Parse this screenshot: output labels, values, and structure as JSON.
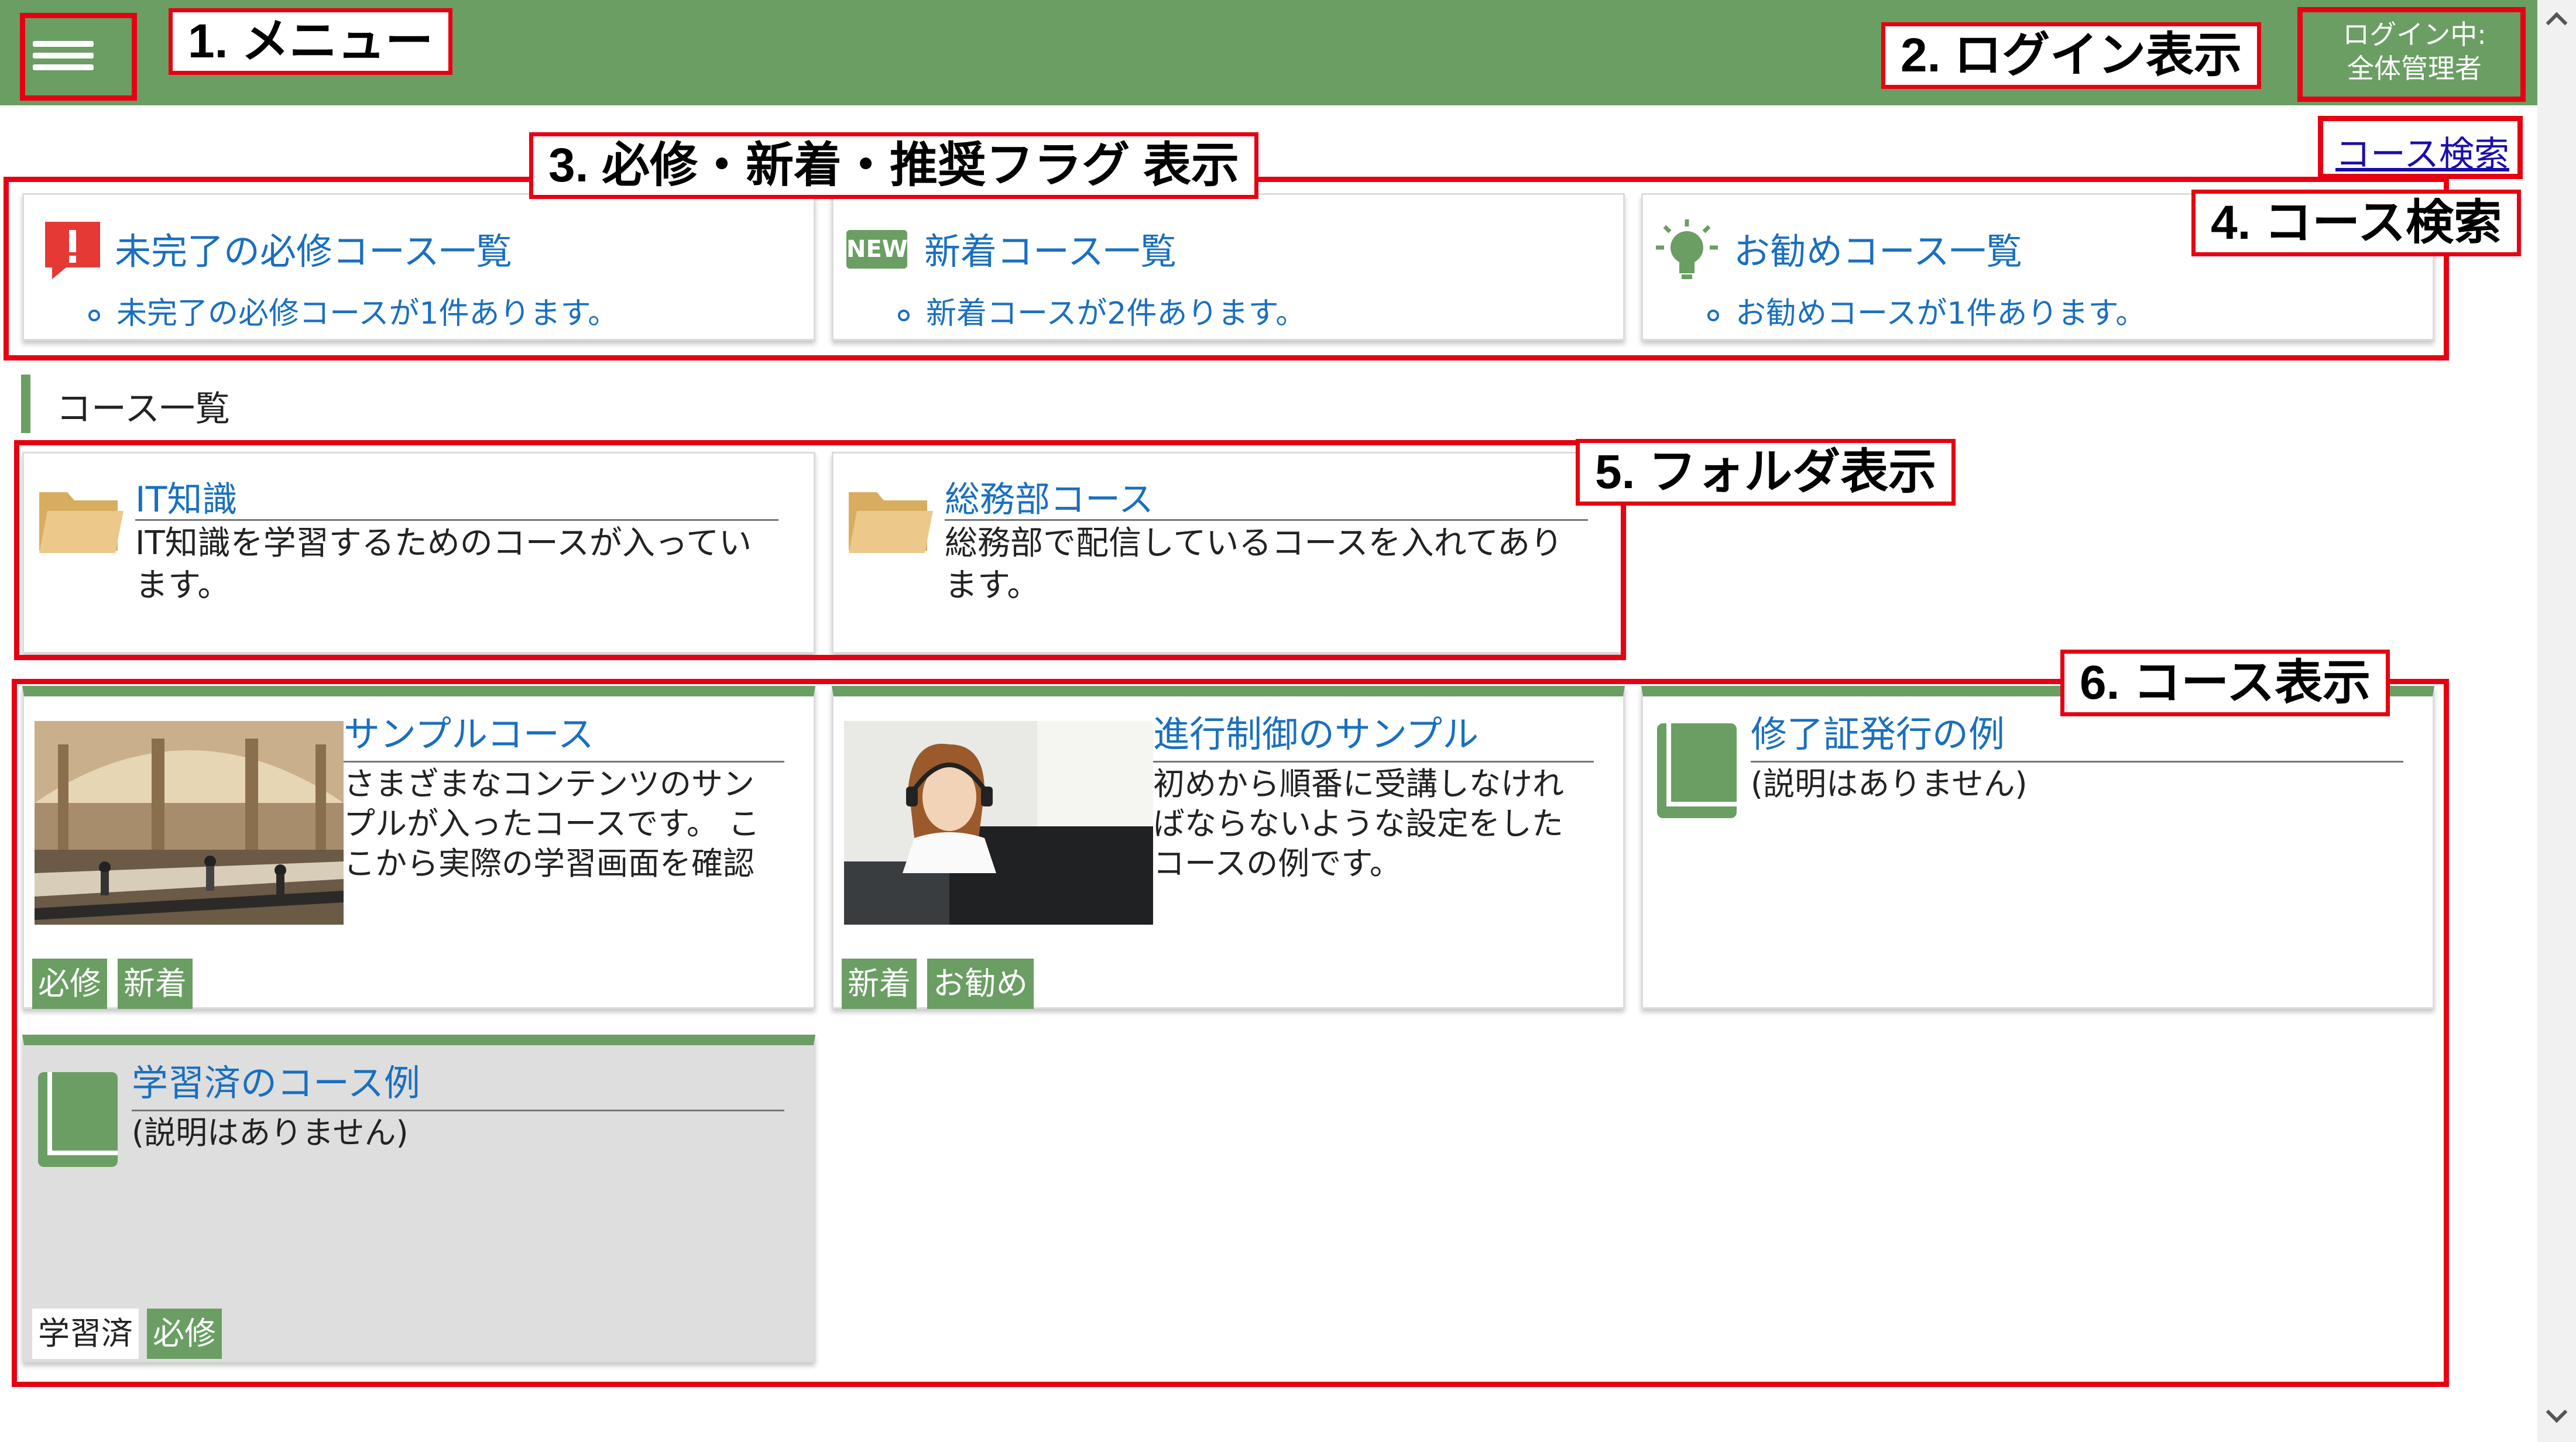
{
  "header": {
    "login_status": "ログイン中:",
    "login_user": "全体管理者"
  },
  "search": {
    "link_label": "コース検索"
  },
  "summary_cards": [
    {
      "title": "未完了の必修コース一覧",
      "detail": "未完了の必修コースが1件あります。",
      "icon": "alert-icon"
    },
    {
      "title": "新着コース一覧",
      "detail": "新着コースが2件あります。",
      "icon": "new-badge-icon",
      "icon_text": "NEW"
    },
    {
      "title": "お勧めコース一覧",
      "detail": "お勧めコースが1件あります。",
      "icon": "lightbulb-icon"
    }
  ],
  "section": {
    "title": "コース一覧"
  },
  "folders": [
    {
      "title": "IT知識",
      "desc": "IT知識を学習するためのコースが入ってい\nます。",
      "icon": "folder-icon"
    },
    {
      "title": "総務部コース",
      "desc": "総務部で配信しているコースを入れてあり\nます。",
      "icon": "folder-icon"
    }
  ],
  "courses": [
    {
      "title": "サンプルコース",
      "desc": "さまざまなコンテンツのサン\nプルが入ったコースです。 こ\nこから実際の学習画面を確認",
      "thumbnail": "station-photo",
      "tags": [
        "必修",
        "新着"
      ]
    },
    {
      "title": "進行制御のサンプル",
      "desc": "初めから順番に受講しなけれ\nばならないような設定をした\nコースの例です。",
      "thumbnail": "headset-woman-photo",
      "tags": [
        "新着",
        "お勧め"
      ]
    },
    {
      "title": "修了証発行の例",
      "desc": "(説明はありません)",
      "icon": "book-icon",
      "tags": []
    },
    {
      "title": "学習済のコース例",
      "desc": "(説明はありません)",
      "icon": "book-icon",
      "tags": [
        "学習済",
        "必修"
      ],
      "completed": true
    }
  ],
  "annotations": {
    "menu": "1. メニュー",
    "login": "2. ログイン表示",
    "flags": "3. 必修・新着・推奨フラグ 表示",
    "search": "4. コース検索",
    "folders": "5. フォルダ表示",
    "courses": "6. コース表示"
  },
  "colors": {
    "brand_green": "#6a9e63",
    "link_blue": "#1a6fbf",
    "annotation_red": "#e60012",
    "alert_red": "#e53935",
    "folder_tan": "#e7c27a",
    "completed_card": "#dedede"
  }
}
